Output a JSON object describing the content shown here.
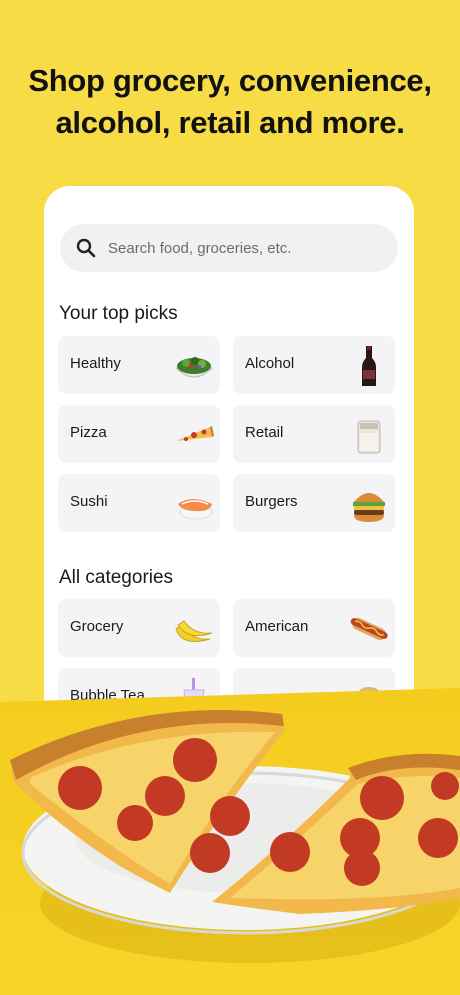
{
  "headline": {
    "line1": "Shop grocery, convenience,",
    "line2": "alcohol, retail and more."
  },
  "search": {
    "placeholder": "Search food, groceries, etc."
  },
  "top_picks": {
    "title": "Your top picks",
    "items": [
      {
        "label": "Healthy",
        "icon": "salad-bowl-icon"
      },
      {
        "label": "Alcohol",
        "icon": "wine-bottle-icon"
      },
      {
        "label": "Pizza",
        "icon": "pizza-slice-icon"
      },
      {
        "label": "Retail",
        "icon": "candle-icon"
      },
      {
        "label": "Sushi",
        "icon": "sushi-icon"
      },
      {
        "label": "Burgers",
        "icon": "burger-icon"
      }
    ]
  },
  "all_categories": {
    "title": "All categories",
    "items": [
      {
        "label": "Grocery",
        "icon": "banana-icon"
      },
      {
        "label": "American",
        "icon": "hotdog-icon"
      },
      {
        "label": "Bubble Tea",
        "icon": "bubble-tea-icon"
      },
      {
        "label": "",
        "icon": "category-icon"
      }
    ]
  },
  "colors": {
    "background": "#f7dc45",
    "card": "#ffffff",
    "tile": "#f4f4f6"
  }
}
